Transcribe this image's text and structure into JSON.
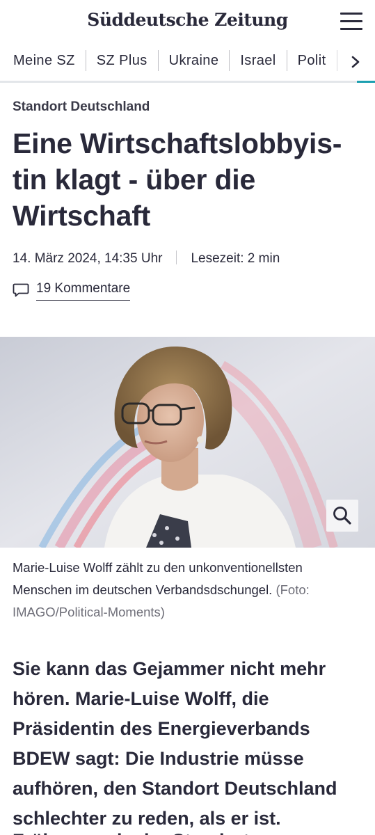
{
  "header": {
    "logo": "Süddeutsche Zeitung",
    "menu_icon": "hamburger-menu-icon"
  },
  "nav": {
    "items": [
      "Meine SZ",
      "SZ Plus",
      "Ukraine",
      "Israel",
      "Polit"
    ],
    "arrow_icon": "chevron-right-icon",
    "accent_color": "#1c9fb0"
  },
  "article": {
    "kicker": "Standort Deutschland",
    "headline": "Eine Wirtschaftslobbyis-tin klagt - über die Wirtschaft",
    "date": "14. März 2024, 14:35 Uhr",
    "read_time": "Lesezeit: 2 min",
    "comments_label": "19 Kommentare",
    "comments_icon": "speech-bubble-icon",
    "zoom_icon": "magnifier-icon",
    "caption": "Marie-Luise Wolff zählt zu den unkonventionellsten Menschen im deutschen Verbandsdschungel.",
    "credit": "(Foto: IMAGO/Political-Moments)",
    "lead": "Sie kann das Gejammer nicht mehr hören. Marie-Luise Wolff, die Präsidentin des Energieverbands BDEW sagt: Die Industrie müsse aufhören, den Standort Deutschland schlechter zu reden, als er ist.",
    "lead_cutoff": "Früher wurde der Standort Deutschland"
  },
  "colors": {
    "text": "#29293a",
    "muted": "#6e6e78"
  }
}
